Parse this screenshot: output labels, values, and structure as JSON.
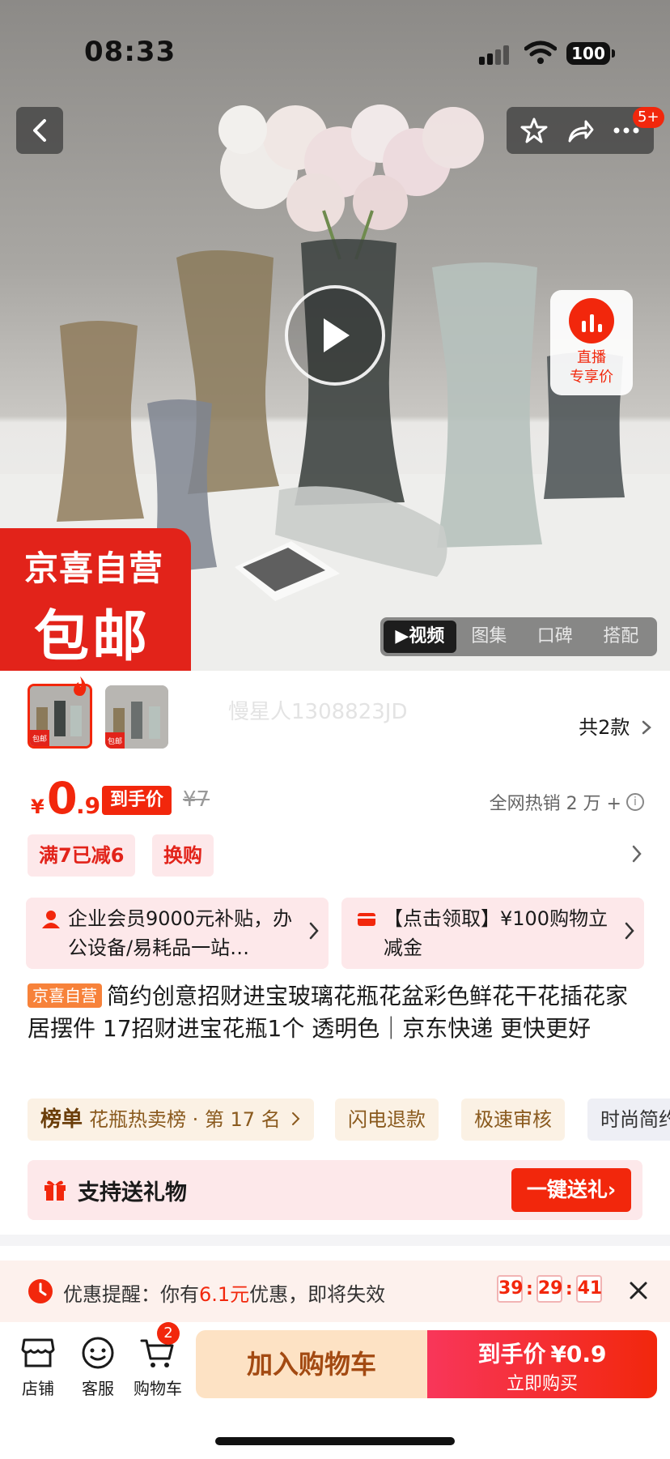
{
  "status_bar": {
    "time": "08:33",
    "battery": "100"
  },
  "header": {
    "notification_badge": "5+"
  },
  "hero": {
    "live_label_1": "直播",
    "live_label_2": "专享价",
    "promo_line1": "京喜自营",
    "promo_line2": "包邮",
    "media_tabs": [
      "▶视频",
      "图集",
      "口碑",
      "搭配"
    ]
  },
  "variants": {
    "watermark": "慢星人1308823JD",
    "count_label": "共2款",
    "thumb_label": "包邮"
  },
  "price": {
    "currency": "¥",
    "integer": "0",
    "decimal": ".9",
    "tag": "到手价",
    "original": "¥7",
    "hot_sales": "全网热销 2 万 +"
  },
  "coupons": [
    "满7已减6",
    "换购"
  ],
  "benefits": [
    {
      "text": "企业会员9000元补贴，办公设备/易耗品一站…"
    },
    {
      "text": "【点击领取】¥100购物立减金"
    }
  ],
  "product": {
    "badge": "京喜自营",
    "title": "简约创意招财进宝玻璃花瓶花盆彩色鲜花干花插花家居摆件 17招财进宝花瓶1个 透明色｜京东快递 更快更好"
  },
  "tags": {
    "rank_bold": "榜单",
    "rank_text": "花瓶热卖榜 · 第 17 名",
    "chips": [
      "闪电退款",
      "极速审核",
      "时尚简约"
    ]
  },
  "gift": {
    "label": "支持送礼物",
    "button": "一键送礼"
  },
  "reminder": {
    "prefix": "优惠提醒：你有",
    "amount": "6.1元",
    "suffix": "优惠，即将失效",
    "countdown": [
      "39",
      "29",
      "41"
    ]
  },
  "bottom_nav": {
    "items": [
      "店铺",
      "客服",
      "购物车"
    ],
    "cart_badge": "2",
    "add_cart": "加入购物车",
    "buy_label": "到手价",
    "buy_price": "¥0.9",
    "buy_sub": "立即购买"
  },
  "colors": {
    "accent": "#f2270c",
    "promo_red": "#e2231a",
    "cart_btn_bg": "#fde2c4"
  }
}
